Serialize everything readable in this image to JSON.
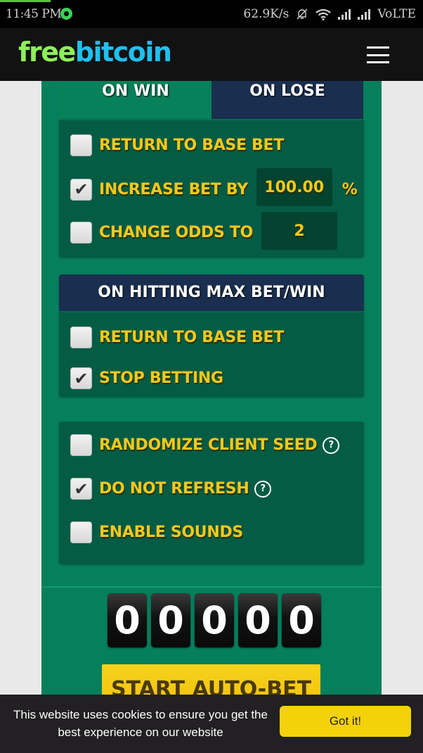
{
  "status_bar": {
    "time": "11:45 PM",
    "notification_icon": "whatsapp-icon",
    "net_speed": "62.9K/s",
    "icons": [
      "bell-muted-icon",
      "wifi-icon",
      "signal-icon",
      "signal-icon"
    ],
    "network_label": "VoLTE"
  },
  "header": {
    "logo_part1": "free",
    "logo_part2": "bitcoin",
    "logo_colors": {
      "free": "#8ef05a",
      "bitcoin": "#1fc0f0"
    },
    "menu_icon": "hamburger-menu-icon"
  },
  "tabs": [
    {
      "label": "ON WIN",
      "active": true
    },
    {
      "label": "ON LOSE",
      "active": false
    }
  ],
  "on_win_options": {
    "return_to_base": {
      "label": "RETURN TO BASE BET",
      "checked": false
    },
    "increase_bet": {
      "label": "INCREASE BET BY",
      "checked": true,
      "value": "100.00",
      "unit": "%"
    },
    "change_odds": {
      "label": "CHANGE ODDS TO",
      "checked": false,
      "value": "2"
    }
  },
  "max_bet_section": {
    "title": "ON HITTING MAX BET/WIN",
    "return_to_base": {
      "label": "RETURN TO BASE BET",
      "checked": false
    },
    "stop_betting": {
      "label": "STOP BETTING",
      "checked": true
    }
  },
  "misc_options": {
    "randomize_seed": {
      "label": "RANDOMIZE CLIENT SEED",
      "checked": false,
      "help": "?"
    },
    "do_not_refresh": {
      "label": "DO NOT REFRESH",
      "checked": true,
      "help": "?"
    },
    "enable_sounds": {
      "label": "ENABLE SOUNDS",
      "checked": false
    }
  },
  "counter": {
    "digits": [
      "0",
      "0",
      "0",
      "0",
      "0"
    ]
  },
  "start_button": {
    "label": "START AUTO-BET"
  },
  "cookie_banner": {
    "message": "This website uses cookies to ensure you get the best experience on our website",
    "button_label": "Got it!"
  },
  "colors": {
    "panel_green": "#057f5c",
    "box_green": "#045c45",
    "navy": "#1a2f4f",
    "label_yellow": "#f2c81e",
    "button_yellow": "#f3d20c"
  }
}
